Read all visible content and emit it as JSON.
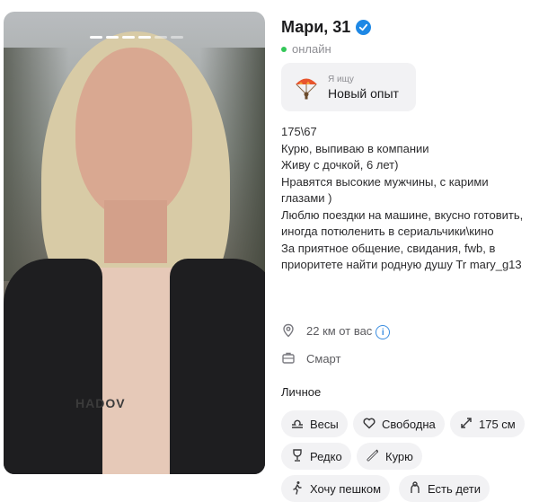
{
  "profile": {
    "name_age": "Мари, 31",
    "status": "онлайн",
    "looking_for": {
      "caption": "Я ищу",
      "value": "Новый опыт"
    },
    "bio": "175\\67\nКурю, выпиваю в компании\nЖиву с дочкой, 6 лет)\nНравятся высокие мужчины, с карими глазами )\nЛюблю поездки на машине, вкусно готовить, иногда потюленить в сериальчики\\кино\nЗа приятное общение, свидания, fwb, в приоритете найти родную душу Tr mary_g13",
    "distance": "22 км от вас",
    "occupation": "Смарт",
    "photo_text": "HADOV"
  },
  "section_title": "Личное",
  "chips": [
    {
      "label": "Весы",
      "icon": "zodiac-libra-icon"
    },
    {
      "label": "Свободна",
      "icon": "heart-icon"
    },
    {
      "label": "175 см",
      "icon": "height-arrows-icon"
    },
    {
      "label": "Редко",
      "icon": "wine-glass-icon"
    },
    {
      "label": "Курю",
      "icon": "cigarette-icon"
    },
    {
      "label": "Хочу пешком",
      "icon": "walking-icon"
    },
    {
      "label": "Есть дети",
      "icon": "child-icon"
    }
  ],
  "colors": {
    "accent": "#1e88e5",
    "online": "#34c759",
    "chip_bg": "#f2f2f4"
  }
}
